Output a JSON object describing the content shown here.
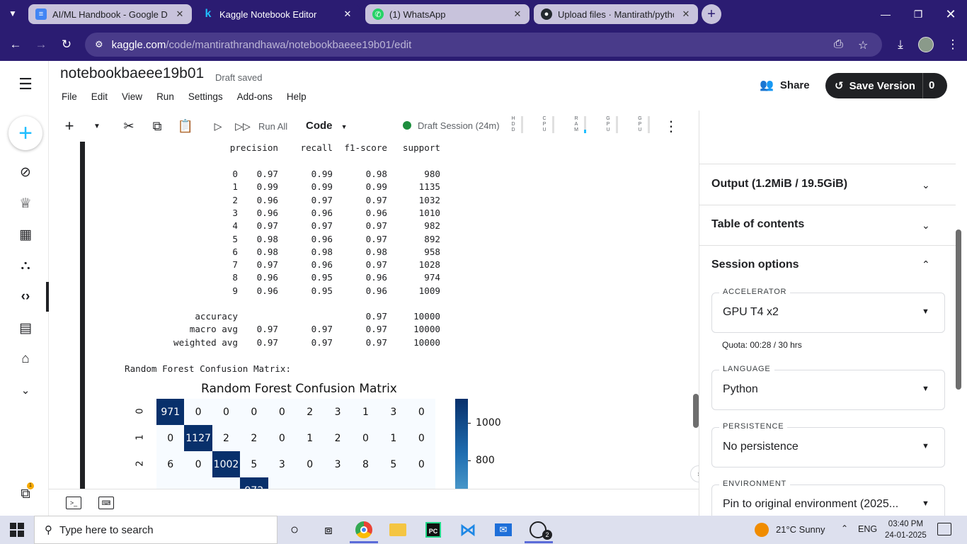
{
  "browser": {
    "tabs": [
      {
        "title": "AI/ML Handbook - Google Doc",
        "icon": "google-docs-icon",
        "fav_color": "#4285f4",
        "fav_glyph": "≡"
      },
      {
        "title": "Kaggle Notebook Editor",
        "icon": "kaggle-icon",
        "fav_color": "#20beff",
        "fav_glyph": "k"
      },
      {
        "title": "(1) WhatsApp",
        "icon": "whatsapp-icon",
        "fav_color": "#25d366",
        "fav_glyph": "✆"
      },
      {
        "title": "Upload files · Mantirath/python",
        "icon": "github-icon",
        "fav_color": "#24292f",
        "fav_glyph": "●"
      }
    ],
    "url_host": "kaggle.com",
    "url_path": "/code/mantirathrandhawa/notebookbaeee19b01/edit"
  },
  "kaggle": {
    "notebook_title": "notebookbaeee19b01",
    "draft_status": "Draft saved",
    "menu": [
      "File",
      "Edit",
      "View",
      "Run",
      "Settings",
      "Add-ons",
      "Help"
    ],
    "share_label": "Share",
    "save_version_label": "Save Version",
    "save_version_count": "0",
    "toolbar": {
      "run_all": "Run All",
      "cell_type": "Code",
      "session": "Draft Session (24m)",
      "meters": [
        "HDD",
        "CPU",
        "RAM",
        "GPU",
        "GPU"
      ]
    }
  },
  "output": {
    "report_header": [
      "precision",
      "recall",
      "f1-score",
      "support"
    ],
    "report_rows": [
      [
        "0",
        "0.97",
        "0.99",
        "0.98",
        "980"
      ],
      [
        "1",
        "0.99",
        "0.99",
        "0.99",
        "1135"
      ],
      [
        "2",
        "0.96",
        "0.97",
        "0.97",
        "1032"
      ],
      [
        "3",
        "0.96",
        "0.96",
        "0.96",
        "1010"
      ],
      [
        "4",
        "0.97",
        "0.97",
        "0.97",
        "982"
      ],
      [
        "5",
        "0.98",
        "0.96",
        "0.97",
        "892"
      ],
      [
        "6",
        "0.98",
        "0.98",
        "0.98",
        "958"
      ],
      [
        "7",
        "0.97",
        "0.96",
        "0.97",
        "1028"
      ],
      [
        "8",
        "0.96",
        "0.95",
        "0.96",
        "974"
      ],
      [
        "9",
        "0.96",
        "0.95",
        "0.96",
        "1009"
      ]
    ],
    "summary_rows": [
      [
        "accuracy",
        "",
        "",
        "0.97",
        "10000"
      ],
      [
        "macro avg",
        "0.97",
        "0.97",
        "0.97",
        "10000"
      ],
      [
        "weighted avg",
        "0.97",
        "0.97",
        "0.97",
        "10000"
      ]
    ],
    "confusion_caption": "Random Forest Confusion Matrix:"
  },
  "chart_data": {
    "type": "heatmap",
    "title": "Random Forest Confusion Matrix",
    "row_labels": [
      "0",
      "1",
      "2"
    ],
    "rows": [
      [
        971,
        0,
        0,
        0,
        0,
        2,
        3,
        1,
        3,
        0
      ],
      [
        0,
        1127,
        2,
        2,
        0,
        1,
        2,
        0,
        1,
        0
      ],
      [
        6,
        0,
        1002,
        5,
        3,
        0,
        3,
        8,
        5,
        0
      ]
    ],
    "partial_row_value": "972",
    "colorbar_ticks": [
      "1000",
      "800"
    ],
    "colorbar_tick_values": [
      1000,
      800
    ],
    "colormap": "Blues"
  },
  "right_panel": {
    "output_label": "Output (1.2MiB / 19.5GiB)",
    "toc_label": "Table of contents",
    "session_options_label": "Session options",
    "accelerator": {
      "label": "ACCELERATOR",
      "value": "GPU T4 x2"
    },
    "quota": "Quota: 00:28 / 30 hrs",
    "language": {
      "label": "LANGUAGE",
      "value": "Python"
    },
    "persistence": {
      "label": "PERSISTENCE",
      "value": "No persistence"
    },
    "environment": {
      "label": "ENVIRONMENT",
      "value": "Pin to original environment (2025..."
    }
  },
  "taskbar": {
    "search_placeholder": "Type here to search",
    "weather": "21°C  Sunny",
    "language": "ENG",
    "time": "03:40 PM",
    "date": "24-01-2025",
    "whatsapp_badge": "2",
    "nav_badge": "1"
  },
  "colors": {
    "chrome_frame": "#2b1c72",
    "kaggle_blue": "#20beff",
    "session_green": "#1e8e3e"
  }
}
